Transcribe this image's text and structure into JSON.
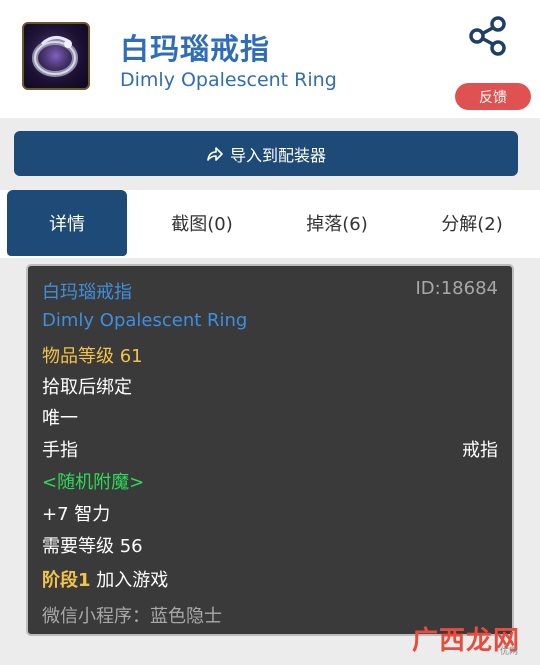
{
  "header": {
    "title_cn": "白玛瑙戒指",
    "title_en": "Dimly Opalescent Ring",
    "feedback_label": "反馈",
    "share_icon": "share-icon",
    "item_icon": "ring-icon"
  },
  "import_button": {
    "label": "导入到配装器",
    "icon": "share-arrow-icon"
  },
  "tabs": [
    {
      "label": "详情",
      "active": true
    },
    {
      "label": "截图(0)",
      "active": false
    },
    {
      "label": "掉落(6)",
      "active": false
    },
    {
      "label": "分解(2)",
      "active": false
    }
  ],
  "tooltip": {
    "name_cn": "白玛瑙戒指",
    "id": "ID:18684",
    "name_en": "Dimly Opalescent Ring",
    "item_level": "物品等级 61",
    "bind": "拾取后绑定",
    "unique": "唯一",
    "slot": "手指",
    "type": "戒指",
    "random_enchant": "<随机附魔>",
    "stat": "+7 智力",
    "required_level": "需要等级 56",
    "phase_label": "阶段1",
    "phase_text": "加入游戏",
    "source_note": "微信小程序：蓝色隐士"
  },
  "watermark": {
    "text": "广西龙网",
    "small": "优网"
  },
  "colors": {
    "accent_blue": "#2f6db8",
    "nav_dark": "#1e4a77",
    "feedback_red": "#e05252",
    "tooltip_bg": "#3a3a3a",
    "quality_blue": "#3d8fe0",
    "item_level_yellow": "#f2c34b",
    "enchant_green": "#2fd95a"
  }
}
